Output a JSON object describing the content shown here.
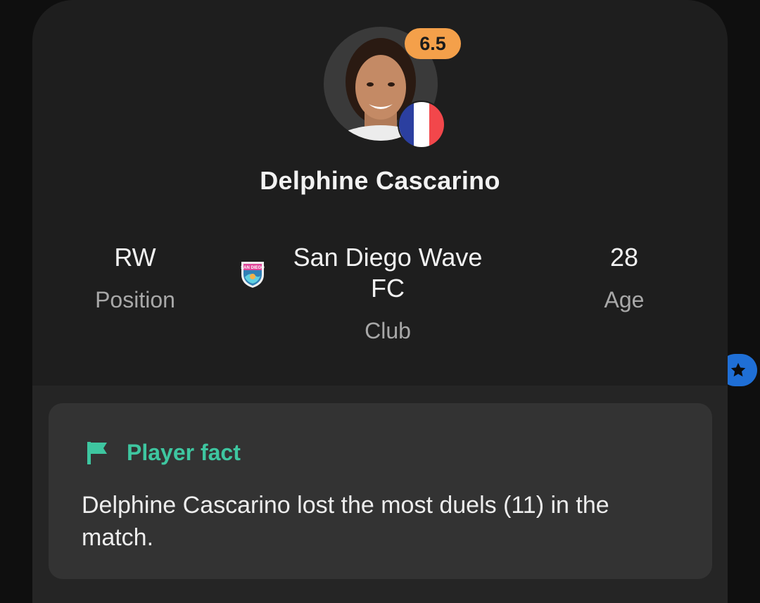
{
  "player": {
    "name": "Delphine Cascarino",
    "rating": "6.5",
    "nationality_flag": [
      "#2b3fa0",
      "#ffffff",
      "#f2474b"
    ],
    "photo_icon": "player-photo"
  },
  "stats": {
    "position": {
      "value": "RW",
      "label": "Position"
    },
    "club": {
      "value": "San Diego Wave FC",
      "label": "Club",
      "logo_text": "SAN DIEGO"
    },
    "age": {
      "value": "28",
      "label": "Age"
    }
  },
  "fact": {
    "title": "Player fact",
    "icon": "flag-icon",
    "text": "Delphine Cascarino lost the most duels (11) in the match."
  },
  "side_button": {
    "icon": "star-icon"
  },
  "colors": {
    "rating_badge": "#f4a04a",
    "accent_green": "#3ec6a0",
    "side_button_blue": "#1f6fd6"
  }
}
